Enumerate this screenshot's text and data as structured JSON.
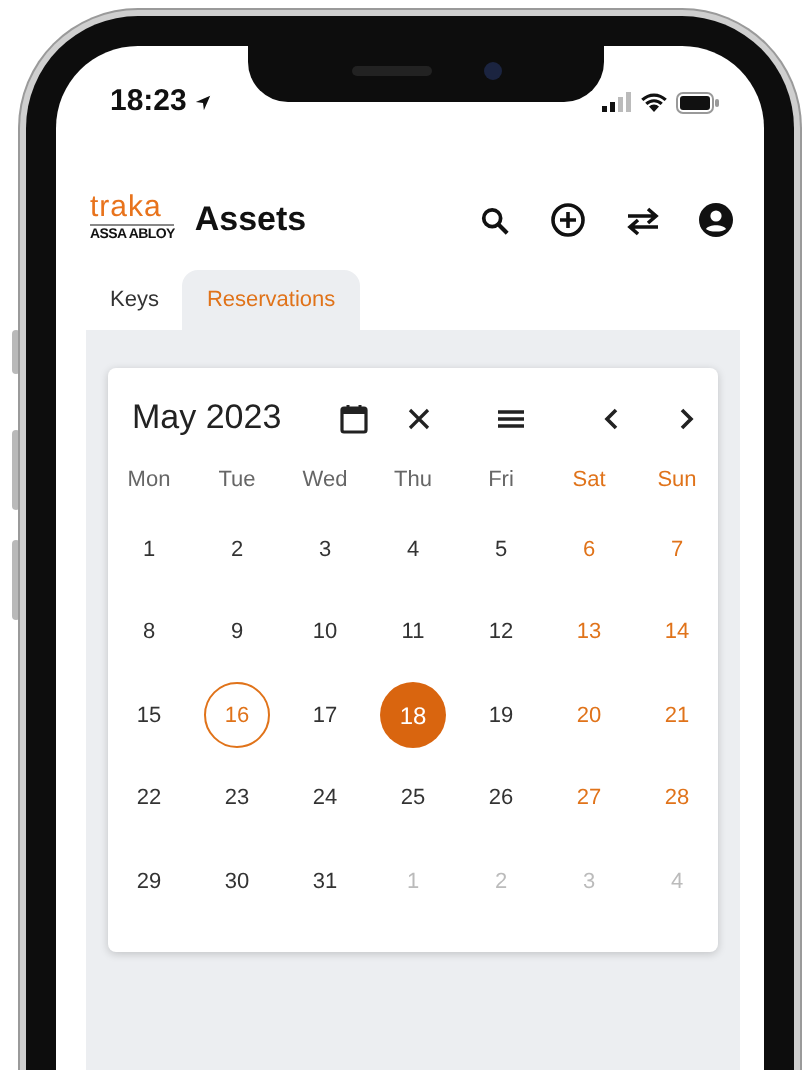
{
  "status_bar": {
    "time": "18:23"
  },
  "app_header": {
    "logo_text": "traka",
    "logo_subtext": "ASSA ABLOY",
    "title": "Assets"
  },
  "tabs": [
    {
      "label": "Keys",
      "selected": false
    },
    {
      "label": "Reservations",
      "selected": true
    }
  ],
  "calendar": {
    "month_label": "May 2023",
    "weekdays": [
      {
        "label": "Mon",
        "weekend": false
      },
      {
        "label": "Tue",
        "weekend": false
      },
      {
        "label": "Wed",
        "weekend": false
      },
      {
        "label": "Thu",
        "weekend": false
      },
      {
        "label": "Fri",
        "weekend": false
      },
      {
        "label": "Sat",
        "weekend": true
      },
      {
        "label": "Sun",
        "weekend": true
      }
    ],
    "weeks": [
      [
        {
          "day": "1",
          "weekend": false,
          "outside": false,
          "today": false,
          "selected": false
        },
        {
          "day": "2",
          "weekend": false,
          "outside": false,
          "today": false,
          "selected": false
        },
        {
          "day": "3",
          "weekend": false,
          "outside": false,
          "today": false,
          "selected": false
        },
        {
          "day": "4",
          "weekend": false,
          "outside": false,
          "today": false,
          "selected": false
        },
        {
          "day": "5",
          "weekend": false,
          "outside": false,
          "today": false,
          "selected": false
        },
        {
          "day": "6",
          "weekend": true,
          "outside": false,
          "today": false,
          "selected": false
        },
        {
          "day": "7",
          "weekend": true,
          "outside": false,
          "today": false,
          "selected": false
        }
      ],
      [
        {
          "day": "8",
          "weekend": false,
          "outside": false,
          "today": false,
          "selected": false
        },
        {
          "day": "9",
          "weekend": false,
          "outside": false,
          "today": false,
          "selected": false
        },
        {
          "day": "10",
          "weekend": false,
          "outside": false,
          "today": false,
          "selected": false
        },
        {
          "day": "11",
          "weekend": false,
          "outside": false,
          "today": false,
          "selected": false
        },
        {
          "day": "12",
          "weekend": false,
          "outside": false,
          "today": false,
          "selected": false
        },
        {
          "day": "13",
          "weekend": true,
          "outside": false,
          "today": false,
          "selected": false
        },
        {
          "day": "14",
          "weekend": true,
          "outside": false,
          "today": false,
          "selected": false
        }
      ],
      [
        {
          "day": "15",
          "weekend": false,
          "outside": false,
          "today": false,
          "selected": false
        },
        {
          "day": "16",
          "weekend": false,
          "outside": false,
          "today": true,
          "selected": false
        },
        {
          "day": "17",
          "weekend": false,
          "outside": false,
          "today": false,
          "selected": false
        },
        {
          "day": "18",
          "weekend": false,
          "outside": false,
          "today": false,
          "selected": true
        },
        {
          "day": "19",
          "weekend": false,
          "outside": false,
          "today": false,
          "selected": false
        },
        {
          "day": "20",
          "weekend": true,
          "outside": false,
          "today": false,
          "selected": false
        },
        {
          "day": "21",
          "weekend": true,
          "outside": false,
          "today": false,
          "selected": false
        }
      ],
      [
        {
          "day": "22",
          "weekend": false,
          "outside": false,
          "today": false,
          "selected": false
        },
        {
          "day": "23",
          "weekend": false,
          "outside": false,
          "today": false,
          "selected": false
        },
        {
          "day": "24",
          "weekend": false,
          "outside": false,
          "today": false,
          "selected": false
        },
        {
          "day": "25",
          "weekend": false,
          "outside": false,
          "today": false,
          "selected": false
        },
        {
          "day": "26",
          "weekend": false,
          "outside": false,
          "today": false,
          "selected": false
        },
        {
          "day": "27",
          "weekend": true,
          "outside": false,
          "today": false,
          "selected": false
        },
        {
          "day": "28",
          "weekend": true,
          "outside": false,
          "today": false,
          "selected": false
        }
      ],
      [
        {
          "day": "29",
          "weekend": false,
          "outside": false,
          "today": false,
          "selected": false
        },
        {
          "day": "30",
          "weekend": false,
          "outside": false,
          "today": false,
          "selected": false
        },
        {
          "day": "31",
          "weekend": false,
          "outside": false,
          "today": false,
          "selected": false
        },
        {
          "day": "1",
          "weekend": false,
          "outside": true,
          "today": false,
          "selected": false
        },
        {
          "day": "2",
          "weekend": false,
          "outside": true,
          "today": false,
          "selected": false
        },
        {
          "day": "3",
          "weekend": true,
          "outside": true,
          "today": false,
          "selected": false
        },
        {
          "day": "4",
          "weekend": true,
          "outside": true,
          "today": false,
          "selected": false
        }
      ]
    ]
  }
}
